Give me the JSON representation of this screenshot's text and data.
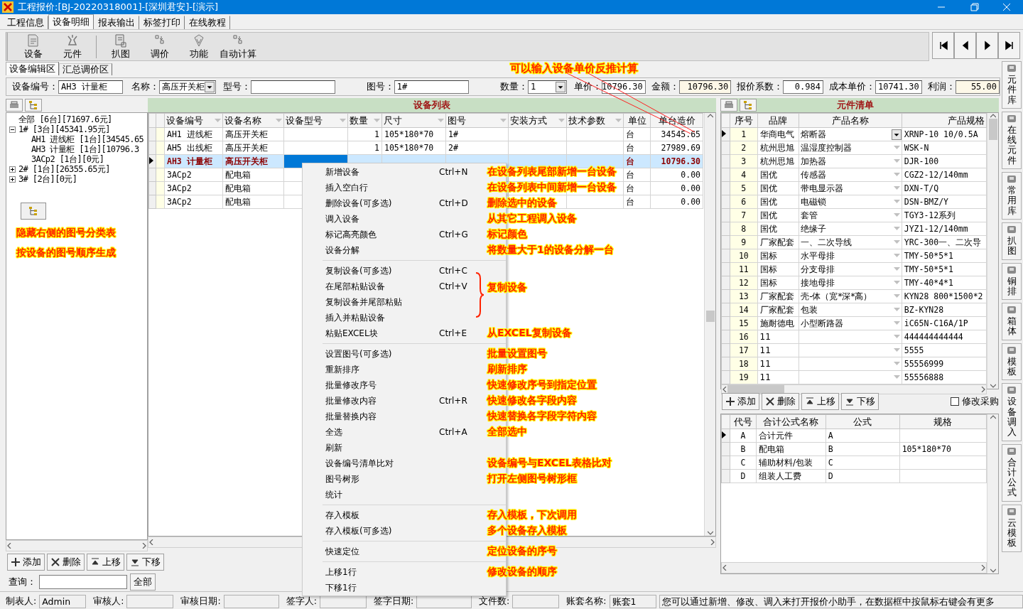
{
  "window": {
    "title": "工程报价:[BJ-20220318001]-[深圳君安]-[演示]"
  },
  "main_tabs": [
    {
      "label": "工程信息",
      "selected": false
    },
    {
      "label": "设备明细",
      "selected": true
    },
    {
      "label": "报表输出",
      "selected": false
    },
    {
      "label": "标签打印",
      "selected": false
    },
    {
      "label": "在线教程",
      "selected": false
    }
  ],
  "toolbar": {
    "groups": [
      [
        "设备",
        "元件"
      ],
      [
        "扒图",
        "调价",
        "功能",
        "自动计算"
      ]
    ]
  },
  "sub_tabs": [
    {
      "label": "设备编辑区",
      "selected": true
    },
    {
      "label": "汇总调价区",
      "selected": false
    }
  ],
  "price_note": "可以输入设备单价反推计算",
  "fields": [
    {
      "label": "设备编号：",
      "value": "AH3 计量柜",
      "kind": "text"
    },
    {
      "label": "名称：",
      "value": "高压开关柜",
      "kind": "select"
    },
    {
      "label": "型号：",
      "kind": "text"
    },
    {
      "label": "图号：",
      "value": "1#",
      "kind": "text"
    },
    {
      "label": "数量：",
      "value": "1",
      "kind": "select"
    },
    {
      "label": "单价：",
      "value": "10796.30",
      "kind": "number"
    },
    {
      "label": "金额：",
      "value": "10796.30",
      "kind": "readonly"
    },
    {
      "label": "报价系数：",
      "value": "0.984",
      "kind": "number"
    },
    {
      "label": "成本单价：",
      "value": "10741.30",
      "kind": "number"
    },
    {
      "label": "利润：",
      "value": "55.00",
      "kind": "readonly"
    }
  ],
  "tree": [
    {
      "label": "全部  [6台][71697.6元]"
    },
    {
      "label": "1#  [3台][45341.95元]",
      "expanded": true,
      "children": [
        {
          "label": "AH1 进线柜  [1台][34545.65"
        },
        {
          "label": "AH3 计量柜  [1台][10796.3"
        },
        {
          "label": "3ACp2  [1台][0元]"
        }
      ]
    },
    {
      "label": "2#  [1台][26355.65元]",
      "expanded": false
    },
    {
      "label": "3#  [2台][0元]",
      "expanded": false
    }
  ],
  "left_notes": [
    "隐藏右侧的图号分类表",
    "按设备的图号顺序生成"
  ],
  "left_actions": [
    "添加",
    "删除",
    "上移",
    "下移"
  ],
  "query": {
    "label": "查询：",
    "button": "全部"
  },
  "device_list": {
    "title": "设备列表",
    "columns": [
      {
        "label": "设备编号",
        "filter": true
      },
      {
        "label": "设备名称",
        "filter": true
      },
      {
        "label": "设备型号",
        "filter": true
      },
      {
        "label": "数量",
        "filter": true
      },
      {
        "label": "尺寸",
        "filter": true
      },
      {
        "label": "图号",
        "filter": true
      },
      {
        "label": "安装方式",
        "filter": true
      },
      {
        "label": "技术参数",
        "filter": true
      },
      {
        "label": "单位",
        "filter": false
      },
      {
        "label": "单台造价",
        "filter": false
      }
    ],
    "rows": [
      {
        "code": "AH1 进线柜",
        "name": "高压开关柜",
        "qty": "1",
        "size": "105*180*70",
        "drawing": "1#",
        "unit": "台",
        "price": "34545.65",
        "selected": false
      },
      {
        "code": "AH5 出线柜",
        "name": "高压开关柜",
        "qty": "1",
        "size": "105*180*70",
        "drawing": "2#",
        "unit": "台",
        "price": "27989.69",
        "selected": false
      },
      {
        "code": "AH3 计量柜",
        "name": "高压开关柜",
        "unit": "台",
        "price": "10796.30",
        "selected": true
      },
      {
        "code": "3ACp2",
        "name": "配电箱",
        "unit": "台",
        "price": "0.00",
        "selected": false
      },
      {
        "code": "3ACp2",
        "name": "配电箱",
        "unit": "台",
        "price": "0.00",
        "selected": false
      },
      {
        "code": "3ACp2",
        "name": "配电箱",
        "unit": "台",
        "price": "0.00",
        "selected": false
      }
    ]
  },
  "context_menu": {
    "groups": [
      {
        "items": [
          {
            "label": "新增设备",
            "shortcut": "Ctrl+N",
            "note": "在设备列表尾部新增一台设备"
          },
          {
            "label": "插入空白行",
            "note": "在设备列表中间新增一台设备"
          },
          {
            "label": "删除设备(可多选)",
            "shortcut": "Ctrl+D",
            "note": "删除选中的设备"
          },
          {
            "label": "调入设备",
            "note": "从其它工程调入设备"
          },
          {
            "label": "标记高亮颜色",
            "shortcut": "Ctrl+G",
            "note": "标记颜色"
          },
          {
            "label": "设备分解",
            "note": "将数量大于1的设备分解一台"
          }
        ]
      },
      {
        "brace_note": "复制设备",
        "items": [
          {
            "label": "复制设备(可多选)",
            "shortcut": "Ctrl+C",
            "in_brace": true
          },
          {
            "label": "在尾部粘贴设备",
            "shortcut": "Ctrl+V",
            "in_brace": true
          },
          {
            "label": "复制设备并尾部粘贴",
            "in_brace": true
          },
          {
            "label": "插入并粘贴设备",
            "in_brace": true
          },
          {
            "label": "粘贴EXCEL块",
            "shortcut": "Ctrl+E",
            "note": "从EXCEL复制设备"
          }
        ]
      },
      {
        "items": [
          {
            "label": "设置图号(可多选)",
            "note": "批量设置图号"
          },
          {
            "label": "重新排序",
            "note": "刷新排序"
          },
          {
            "label": "批量修改序号",
            "note": "快速修改序号到指定位置"
          },
          {
            "label": "批量修改内容",
            "shortcut": "Ctrl+R",
            "note": "快速修改各字段内容"
          },
          {
            "label": "批量替换内容",
            "note": "快速替换各字段字符内容"
          },
          {
            "label": "全选",
            "shortcut": "Ctrl+A",
            "note": "全部选中"
          },
          {
            "label": "刷新"
          },
          {
            "label": "设备编号清单比对",
            "note": "设备编号与EXCEL表格比对"
          },
          {
            "label": "图号树形",
            "note": "打开左侧图号树形框"
          },
          {
            "label": "统计"
          }
        ]
      },
      {
        "items": [
          {
            "label": "存入模板",
            "note": "存入模板，下次调用"
          },
          {
            "label": "存入模板(可多选)",
            "note": "多个设备存入模板"
          }
        ]
      },
      {
        "items": [
          {
            "label": "快速定位",
            "note": "定位设备的序号"
          }
        ]
      },
      {
        "items": [
          {
            "label": "上移1行",
            "note": "修改设备的顺序"
          },
          {
            "label": "下移1行"
          }
        ]
      }
    ]
  },
  "parts_list": {
    "title": "元件清单",
    "columns": [
      "序号",
      "品牌",
      "产品名称",
      "产品规格"
    ],
    "rows": [
      {
        "no": "1",
        "brand": "华商电气",
        "name": "熔断器",
        "spec": "XRNP-10 10/0.5A",
        "selected": true
      },
      {
        "no": "2",
        "brand": "杭州思旭",
        "name": "温湿度控制器",
        "spec": "WSK-N",
        "selected": false
      },
      {
        "no": "3",
        "brand": "杭州思旭",
        "name": "加热器",
        "spec": "DJR-100",
        "selected": false
      },
      {
        "no": "4",
        "brand": "国优",
        "name": "传感器",
        "spec": "CGZ2-12/140mm",
        "selected": false
      },
      {
        "no": "5",
        "brand": "国优",
        "name": "带电显示器",
        "spec": "DXN-T/Q",
        "selected": false
      },
      {
        "no": "6",
        "brand": "国优",
        "name": "电磁锁",
        "spec": "DSN-BMZ/Y",
        "selected": false
      },
      {
        "no": "7",
        "brand": "国优",
        "name": "套管",
        "spec": "TGY3-12系列",
        "selected": false
      },
      {
        "no": "8",
        "brand": "国优",
        "name": "绝缘子",
        "spec": "JYZ1-12/140mm",
        "selected": false
      },
      {
        "no": "9",
        "brand": "厂家配套",
        "name": "一、二次导线",
        "spec": "YRC-300一、二次导",
        "selected": false
      },
      {
        "no": "10",
        "brand": "国标",
        "name": "水平母排",
        "spec": "TMY-50*5*1",
        "selected": false
      },
      {
        "no": "11",
        "brand": "国标",
        "name": "分支母排",
        "spec": "TMY-50*5*1",
        "selected": false
      },
      {
        "no": "12",
        "brand": "国标",
        "name": "接地母排",
        "spec": "TMY-40*4*1",
        "selected": false
      },
      {
        "no": "13",
        "brand": "厂家配套",
        "name": "壳-体（宽*深*高）",
        "spec": "KYN28 800*1500*2",
        "selected": false
      },
      {
        "no": "14",
        "brand": "厂家配套",
        "name": "包装",
        "spec": "BZ-KYN28",
        "selected": false
      },
      {
        "no": "15",
        "brand": "施耐德电",
        "name": "小型断路器",
        "spec": "iC65N-C16A/1P",
        "selected": false
      },
      {
        "no": "16",
        "brand": "11",
        "spec": "444444444444",
        "selected": false
      },
      {
        "no": "17",
        "brand": "11",
        "spec": "5555",
        "selected": false
      },
      {
        "no": "18",
        "brand": "11",
        "spec": "55556999",
        "selected": false
      },
      {
        "no": "19",
        "brand": "11",
        "spec": "55556888",
        "selected": false
      }
    ]
  },
  "parts_actions": [
    "添加",
    "删除",
    "上移",
    "下移"
  ],
  "modify_purchase": {
    "label": "修改采购",
    "checked": false
  },
  "formulas": {
    "columns": [
      "代号",
      "合计公式名称",
      "公式",
      "规格"
    ],
    "rows": [
      {
        "code": "A",
        "name": "合计元件",
        "formula": "A",
        "selected": true
      },
      {
        "code": "B",
        "name": "配电箱",
        "formula": "B",
        "spec": "105*180*70",
        "selected": false
      },
      {
        "code": "C",
        "name": "辅助材料/包装",
        "formula": "C",
        "selected": false
      },
      {
        "code": "D",
        "name": "组装人工费",
        "formula": "D",
        "selected": false
      }
    ]
  },
  "side_tools": [
    "元件库",
    "在线元件",
    "常用库",
    "扒图",
    "铜排",
    "箱体",
    "模板",
    "设备调入",
    "合计公式",
    "云模板"
  ],
  "status_bar": [
    {
      "label": "制表人:",
      "value": "Admin"
    },
    {
      "label": "审核人:"
    },
    {
      "label": "审核日期:"
    },
    {
      "label": "签字人:"
    },
    {
      "label": "签字日期:"
    },
    {
      "label": "文件数:"
    },
    {
      "label": "账套名称:",
      "value": "账套1"
    }
  ],
  "status_message": "您可以通过新增、修改、调入来打开报价小助手，在数据框中按鼠标右键会有更多"
}
